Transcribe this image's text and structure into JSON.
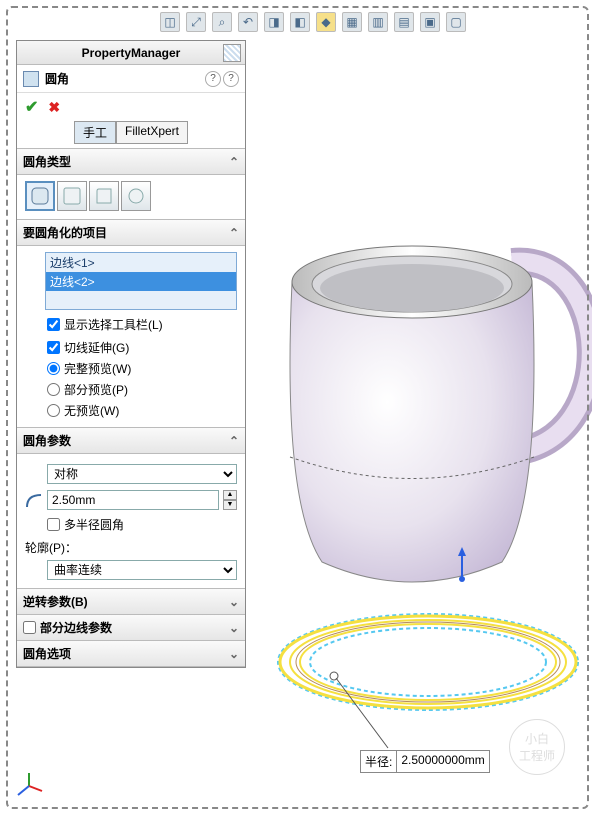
{
  "pm": {
    "title": "PropertyManager"
  },
  "feature": {
    "name": "圆角"
  },
  "tabs": {
    "manual": "手工",
    "xpert": "FilletXpert"
  },
  "section_type": {
    "title": "圆角类型"
  },
  "section_items": {
    "title": "要圆角化的项目",
    "edge1": "边线<1>",
    "edge2": "边线<2>",
    "show_toolbar": "显示选择工具栏(L)",
    "tangent": "切线延伸(G)",
    "full_preview": "完整预览(W)",
    "partial_preview": "部分预览(P)",
    "no_preview": "无预览(W)"
  },
  "section_params": {
    "title": "圆角参数",
    "symmetric": "对称",
    "radius": "2.50mm",
    "multi": "多半径圆角",
    "profile_lbl": "轮廓(P)：",
    "curvature": "曲率连续"
  },
  "section_reverse": {
    "title": "逆转参数(B)"
  },
  "section_partial": {
    "title": "部分边线参数"
  },
  "section_options": {
    "title": "圆角选项"
  },
  "callout": {
    "label": "半径:",
    "value": "2.50000000mm"
  },
  "watermark": {
    "l1": "小白",
    "l2": "工程师"
  }
}
